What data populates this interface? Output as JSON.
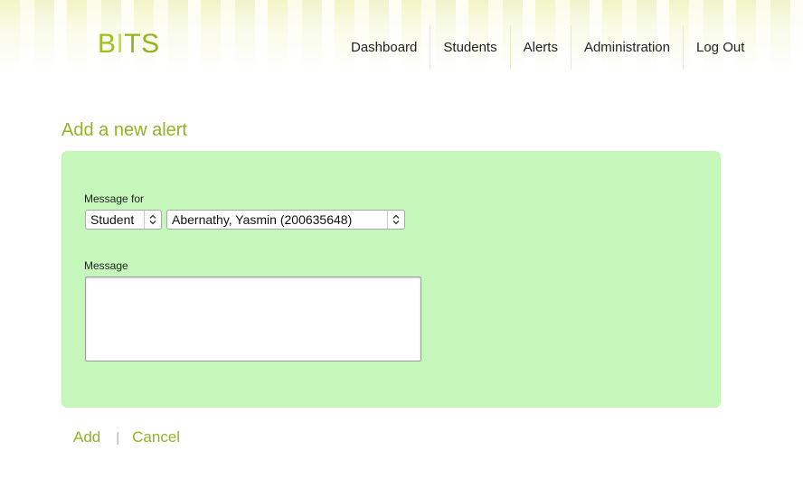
{
  "header": {
    "logo": {
      "part1": "B",
      "part2": "I",
      "part3": "TS"
    },
    "nav": [
      {
        "label": "Dashboard"
      },
      {
        "label": "Students"
      },
      {
        "label": "Alerts"
      },
      {
        "label": "Administration"
      },
      {
        "label": "Log Out"
      }
    ]
  },
  "page": {
    "title": "Add a new alert"
  },
  "form": {
    "message_for": {
      "label": "Message for",
      "recipient_type": {
        "selected": "Student"
      },
      "recipient": {
        "selected": "Abernathy, Yasmin (200635648)"
      }
    },
    "message": {
      "label": "Message",
      "value": ""
    }
  },
  "actions": {
    "add_label": "Add",
    "separator": "|",
    "cancel_label": "Cancel"
  },
  "colors": {
    "brand_green": "#8fb523",
    "panel_background": "#c4f7b9"
  },
  "icons": {
    "select_arrows": "updown-chevron-icon"
  }
}
